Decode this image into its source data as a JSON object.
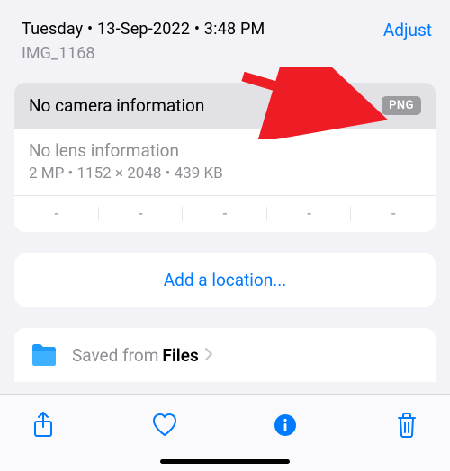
{
  "header": {
    "timestamp": "Tuesday • 13-Sep-2022 • 3:48 PM",
    "filename": "IMG_1168",
    "adjust_label": "Adjust"
  },
  "camera": {
    "text": "No camera information",
    "format_badge": "PNG"
  },
  "lens": {
    "title": "No lens information",
    "meta": "2 MP • 1152 × 2048 • 439 KB"
  },
  "exif": [
    "-",
    "-",
    "-",
    "-",
    "-"
  ],
  "location": {
    "add_label": "Add a location..."
  },
  "source": {
    "prefix": "Saved from ",
    "app": "Files"
  }
}
